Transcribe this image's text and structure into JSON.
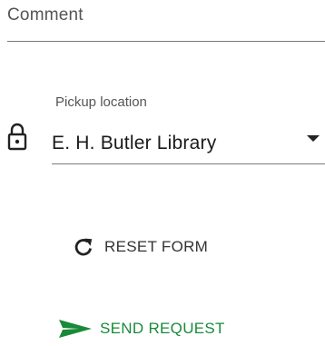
{
  "comment": {
    "label": "Comment"
  },
  "pickup": {
    "label": "Pickup location",
    "selected": "E. H. Butler Library",
    "lock_icon": "lock-icon",
    "arrow_icon": "dropdown-arrow-icon"
  },
  "actions": {
    "reset_label": "RESET FORM",
    "reset_icon": "refresh-icon",
    "send_label": "SEND REQUEST",
    "send_icon": "send-icon"
  },
  "colors": {
    "send_accent": "#1a8a3a",
    "text_dark": "#1a1a1a",
    "label_gray": "#555555",
    "line_gray": "#7a7a7a"
  }
}
